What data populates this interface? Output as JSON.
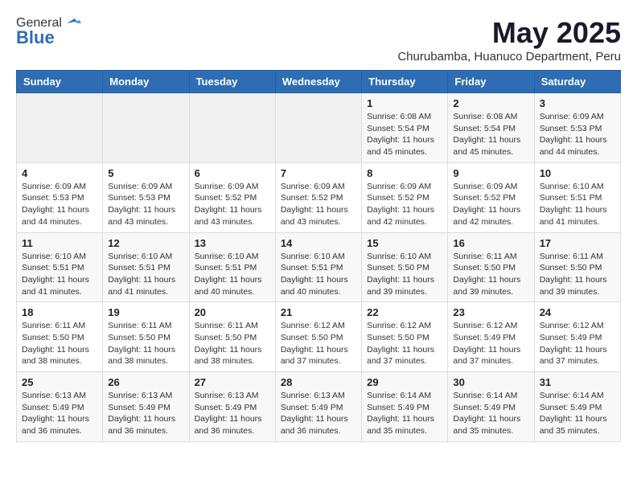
{
  "logo": {
    "general": "General",
    "blue": "Blue"
  },
  "title": "May 2025",
  "location": "Churubamba, Huanuco Department, Peru",
  "days_of_week": [
    "Sunday",
    "Monday",
    "Tuesday",
    "Wednesday",
    "Thursday",
    "Friday",
    "Saturday"
  ],
  "weeks": [
    [
      {
        "day": "",
        "info": ""
      },
      {
        "day": "",
        "info": ""
      },
      {
        "day": "",
        "info": ""
      },
      {
        "day": "",
        "info": ""
      },
      {
        "day": "1",
        "info": "Sunrise: 6:08 AM\nSunset: 5:54 PM\nDaylight: 11 hours\nand 45 minutes."
      },
      {
        "day": "2",
        "info": "Sunrise: 6:08 AM\nSunset: 5:54 PM\nDaylight: 11 hours\nand 45 minutes."
      },
      {
        "day": "3",
        "info": "Sunrise: 6:09 AM\nSunset: 5:53 PM\nDaylight: 11 hours\nand 44 minutes."
      }
    ],
    [
      {
        "day": "4",
        "info": "Sunrise: 6:09 AM\nSunset: 5:53 PM\nDaylight: 11 hours\nand 44 minutes."
      },
      {
        "day": "5",
        "info": "Sunrise: 6:09 AM\nSunset: 5:53 PM\nDaylight: 11 hours\nand 43 minutes."
      },
      {
        "day": "6",
        "info": "Sunrise: 6:09 AM\nSunset: 5:52 PM\nDaylight: 11 hours\nand 43 minutes."
      },
      {
        "day": "7",
        "info": "Sunrise: 6:09 AM\nSunset: 5:52 PM\nDaylight: 11 hours\nand 43 minutes."
      },
      {
        "day": "8",
        "info": "Sunrise: 6:09 AM\nSunset: 5:52 PM\nDaylight: 11 hours\nand 42 minutes."
      },
      {
        "day": "9",
        "info": "Sunrise: 6:09 AM\nSunset: 5:52 PM\nDaylight: 11 hours\nand 42 minutes."
      },
      {
        "day": "10",
        "info": "Sunrise: 6:10 AM\nSunset: 5:51 PM\nDaylight: 11 hours\nand 41 minutes."
      }
    ],
    [
      {
        "day": "11",
        "info": "Sunrise: 6:10 AM\nSunset: 5:51 PM\nDaylight: 11 hours\nand 41 minutes."
      },
      {
        "day": "12",
        "info": "Sunrise: 6:10 AM\nSunset: 5:51 PM\nDaylight: 11 hours\nand 41 minutes."
      },
      {
        "day": "13",
        "info": "Sunrise: 6:10 AM\nSunset: 5:51 PM\nDaylight: 11 hours\nand 40 minutes."
      },
      {
        "day": "14",
        "info": "Sunrise: 6:10 AM\nSunset: 5:51 PM\nDaylight: 11 hours\nand 40 minutes."
      },
      {
        "day": "15",
        "info": "Sunrise: 6:10 AM\nSunset: 5:50 PM\nDaylight: 11 hours\nand 39 minutes."
      },
      {
        "day": "16",
        "info": "Sunrise: 6:11 AM\nSunset: 5:50 PM\nDaylight: 11 hours\nand 39 minutes."
      },
      {
        "day": "17",
        "info": "Sunrise: 6:11 AM\nSunset: 5:50 PM\nDaylight: 11 hours\nand 39 minutes."
      }
    ],
    [
      {
        "day": "18",
        "info": "Sunrise: 6:11 AM\nSunset: 5:50 PM\nDaylight: 11 hours\nand 38 minutes."
      },
      {
        "day": "19",
        "info": "Sunrise: 6:11 AM\nSunset: 5:50 PM\nDaylight: 11 hours\nand 38 minutes."
      },
      {
        "day": "20",
        "info": "Sunrise: 6:11 AM\nSunset: 5:50 PM\nDaylight: 11 hours\nand 38 minutes."
      },
      {
        "day": "21",
        "info": "Sunrise: 6:12 AM\nSunset: 5:50 PM\nDaylight: 11 hours\nand 37 minutes."
      },
      {
        "day": "22",
        "info": "Sunrise: 6:12 AM\nSunset: 5:50 PM\nDaylight: 11 hours\nand 37 minutes."
      },
      {
        "day": "23",
        "info": "Sunrise: 6:12 AM\nSunset: 5:49 PM\nDaylight: 11 hours\nand 37 minutes."
      },
      {
        "day": "24",
        "info": "Sunrise: 6:12 AM\nSunset: 5:49 PM\nDaylight: 11 hours\nand 37 minutes."
      }
    ],
    [
      {
        "day": "25",
        "info": "Sunrise: 6:13 AM\nSunset: 5:49 PM\nDaylight: 11 hours\nand 36 minutes."
      },
      {
        "day": "26",
        "info": "Sunrise: 6:13 AM\nSunset: 5:49 PM\nDaylight: 11 hours\nand 36 minutes."
      },
      {
        "day": "27",
        "info": "Sunrise: 6:13 AM\nSunset: 5:49 PM\nDaylight: 11 hours\nand 36 minutes."
      },
      {
        "day": "28",
        "info": "Sunrise: 6:13 AM\nSunset: 5:49 PM\nDaylight: 11 hours\nand 36 minutes."
      },
      {
        "day": "29",
        "info": "Sunrise: 6:14 AM\nSunset: 5:49 PM\nDaylight: 11 hours\nand 35 minutes."
      },
      {
        "day": "30",
        "info": "Sunrise: 6:14 AM\nSunset: 5:49 PM\nDaylight: 11 hours\nand 35 minutes."
      },
      {
        "day": "31",
        "info": "Sunrise: 6:14 AM\nSunset: 5:49 PM\nDaylight: 11 hours\nand 35 minutes."
      }
    ]
  ]
}
